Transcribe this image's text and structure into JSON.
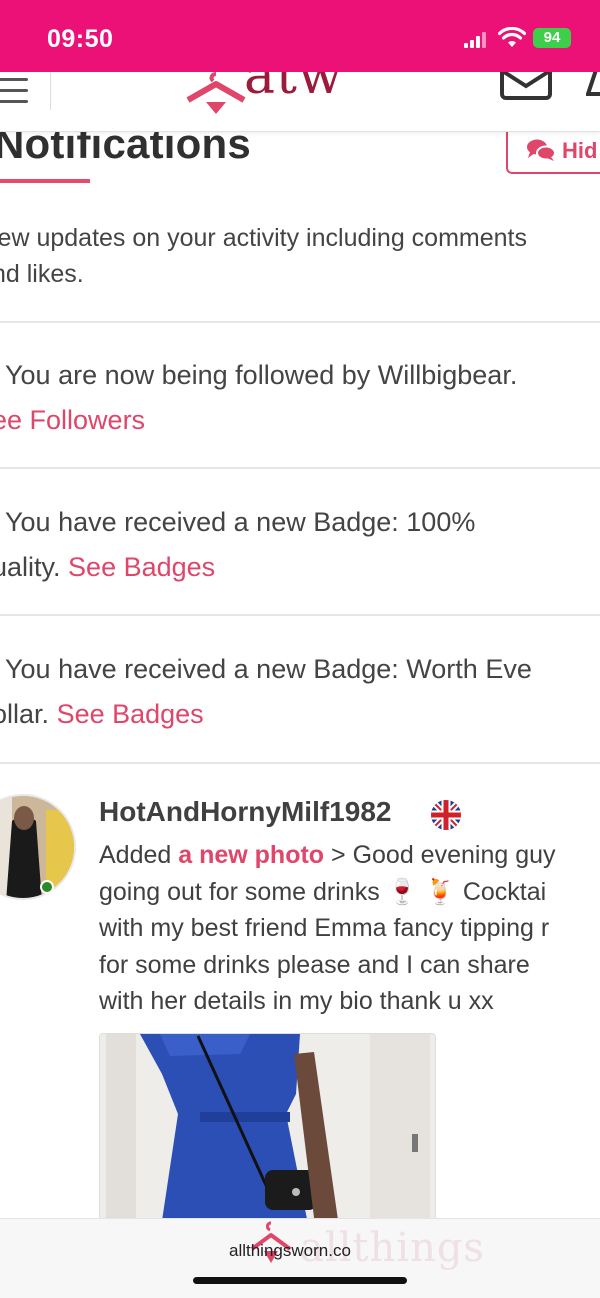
{
  "status_bar": {
    "time": "09:50",
    "battery": "94",
    "icons": [
      "signal-icon",
      "wifi-icon",
      "battery-icon"
    ]
  },
  "header": {
    "logo_text": "atw",
    "icons": [
      "hamburger-menu-icon",
      "mail-icon",
      "bell-icon"
    ]
  },
  "page": {
    "title": "Notifications",
    "hide_button_label": "Hid",
    "intro_line1": "iew updates on your activity including comments",
    "intro_line2": "nd likes."
  },
  "notifications": [
    {
      "line1": "You are now being followed by Willbigbear.",
      "prefix2": "",
      "link": "ee Followers"
    },
    {
      "line1": "You have received a new Badge: 100%",
      "prefix2": "uality.",
      "link": "See Badges"
    },
    {
      "line1": "You have received a new Badge: Worth Eve",
      "prefix2": "ollar.",
      "link": "See Badges"
    }
  ],
  "feed_item": {
    "username": "HotAndHornyMilf1982",
    "flag": "uk-flag-icon",
    "added": "Added",
    "link": "a new photo",
    "text_after_link": "> Good evening guy",
    "line2": "going out for some drinks",
    "line2_emojis": "🍷 🍹",
    "line2_tail": "Cocktai",
    "line3": "with my best friend Emma fancy tipping r",
    "line4": "for some drinks please and I can share",
    "line5": "with her details in my bio thank u xx"
  },
  "footer": {
    "domain": "allthingsworn.co",
    "watermark": "allthings"
  },
  "colors": {
    "status_bar": "#ec1177",
    "accent": "#e0456a",
    "logo": "#9b1b3a",
    "battery": "#3ecf4a"
  }
}
